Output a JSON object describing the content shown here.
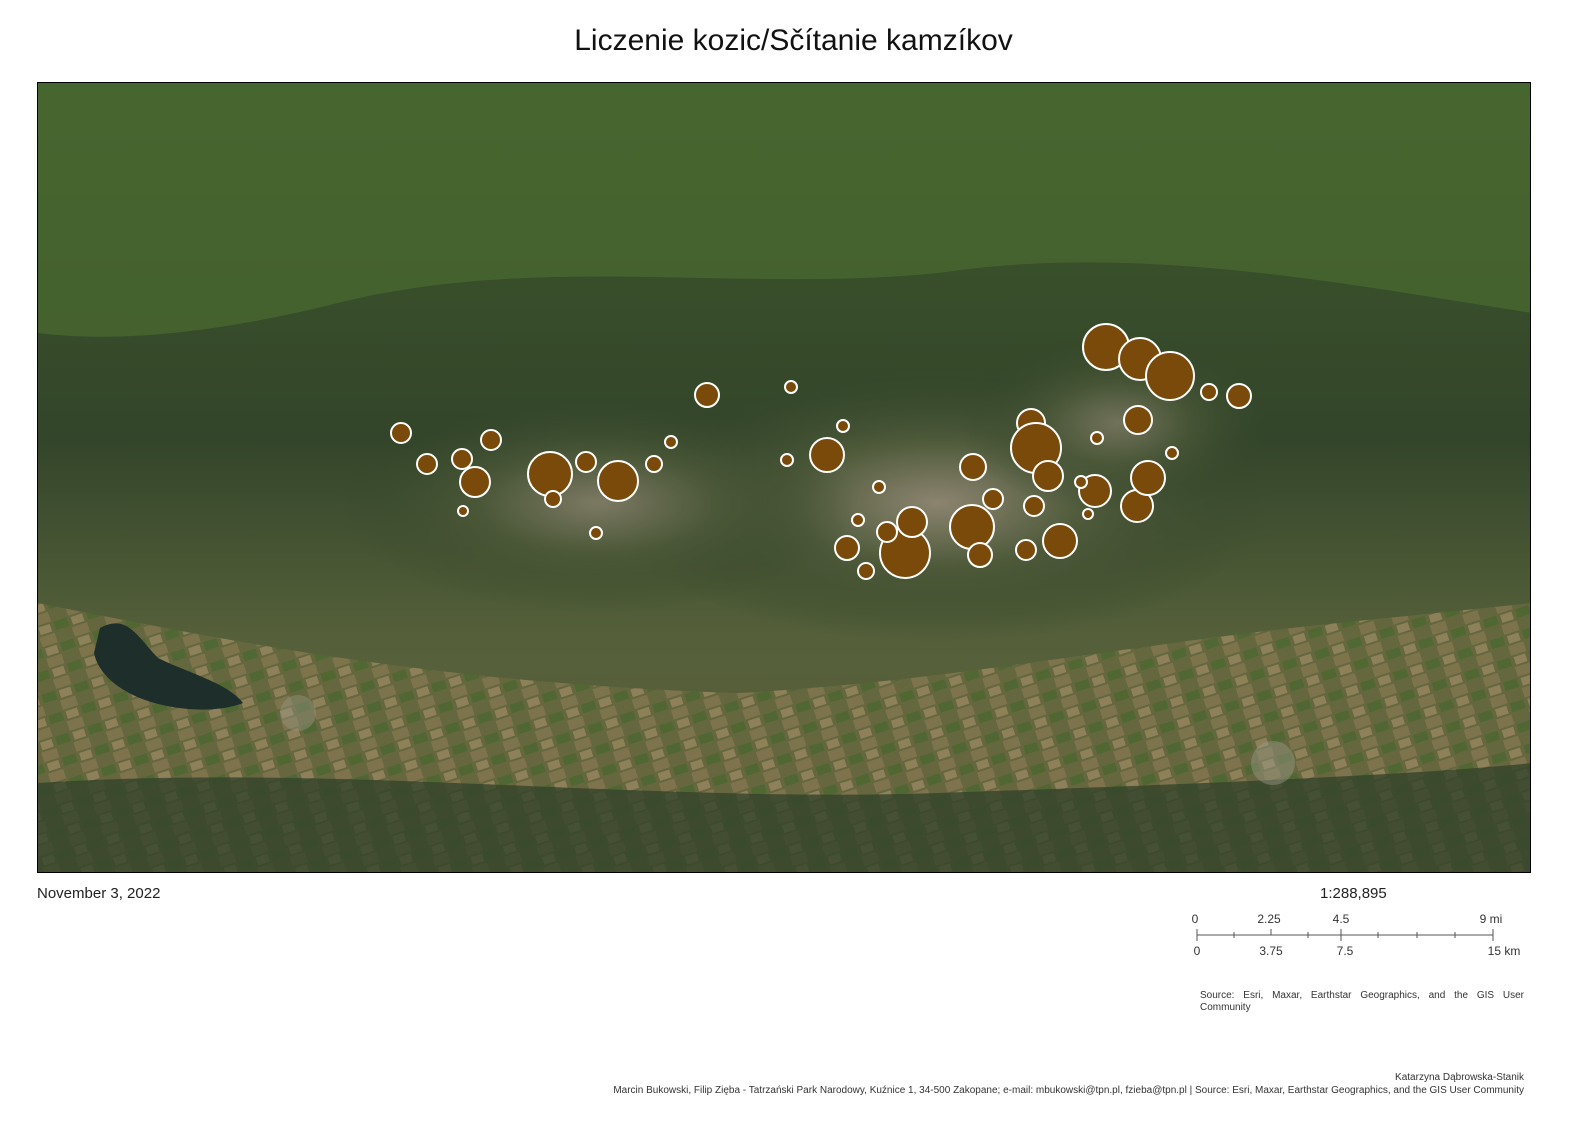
{
  "map": {
    "title": "Liczenie kozic/Sčítanie kamzíkov",
    "date": "November 3, 2022",
    "scale_ratio": "1:288,895",
    "scale_bar": {
      "miles_labels": [
        "0",
        "2.25",
        "4.5",
        "9 mi"
      ],
      "km_labels": [
        "0",
        "3.75",
        "7.5",
        "15 km"
      ]
    },
    "source": "Source: Esri, Maxar, Earthstar Geographics, and the GIS User Community",
    "author": "Katarzyna Dąbrowska-Stanik",
    "credits": "Marcin Bukowski, Filip Zięba - Tatrzański Park Narodowy, Kuźnice 1, 34-500 Zakopane; e-mail: mbukowski@tpn.pl, fzieba@tpn.pl | Source: Esri, Maxar, Earthstar Geographics, and the GIS User Community",
    "basemap": "satellite imagery",
    "symbol_color": "#7a4a0a",
    "symbol_outline": "#ffffff"
  }
}
